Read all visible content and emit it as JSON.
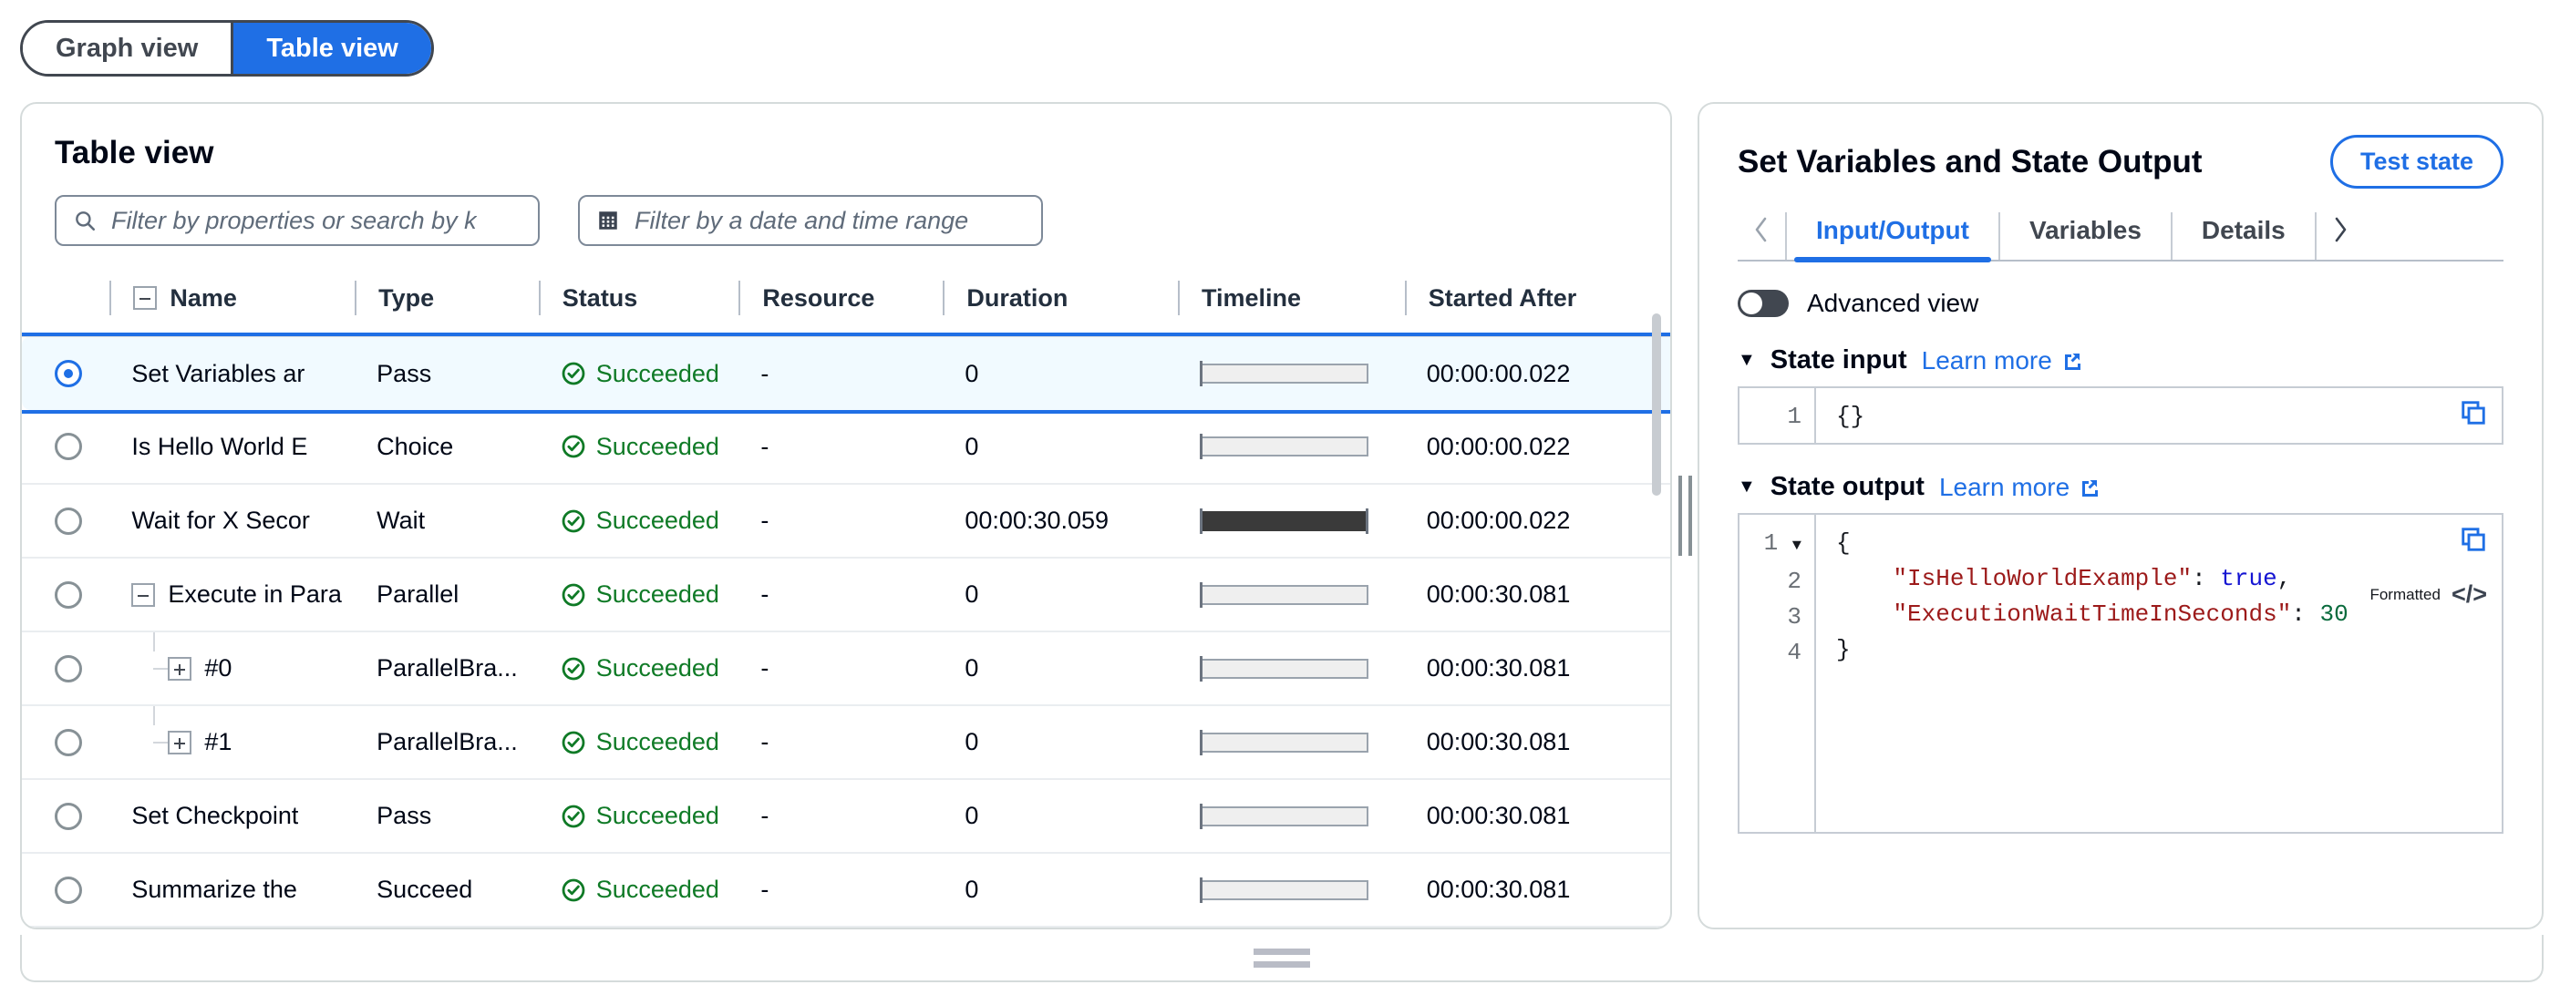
{
  "view_toggle": {
    "options": [
      {
        "label": "Graph view",
        "active": false
      },
      {
        "label": "Table view",
        "active": true
      }
    ]
  },
  "left_panel": {
    "title": "Table view",
    "search": {
      "placeholder": "Filter by properties or search by k",
      "icon": "search-icon"
    },
    "date_filter": {
      "placeholder": "Filter by a date and time range",
      "icon": "calendar-icon"
    },
    "columns": [
      {
        "key": "select",
        "label": ""
      },
      {
        "key": "name",
        "label": "Name"
      },
      {
        "key": "type",
        "label": "Type"
      },
      {
        "key": "status",
        "label": "Status"
      },
      {
        "key": "resource",
        "label": "Resource"
      },
      {
        "key": "duration",
        "label": "Duration"
      },
      {
        "key": "timeline",
        "label": "Timeline"
      },
      {
        "key": "started_after",
        "label": "Started After"
      }
    ],
    "rows": [
      {
        "selected": true,
        "indent": 0,
        "expander": "none",
        "name": "Set Variables ar",
        "type": "Pass",
        "status": "Succeeded",
        "resource": "-",
        "duration": "0",
        "timeline_filled": false,
        "started_after": "00:00:00.022"
      },
      {
        "selected": false,
        "indent": 0,
        "expander": "none",
        "name": "Is Hello World E",
        "type": "Choice",
        "status": "Succeeded",
        "resource": "-",
        "duration": "0",
        "timeline_filled": false,
        "started_after": "00:00:00.022"
      },
      {
        "selected": false,
        "indent": 0,
        "expander": "none",
        "name": "Wait for X Secor",
        "type": "Wait",
        "status": "Succeeded",
        "resource": "-",
        "duration": "00:00:30.059",
        "timeline_filled": true,
        "started_after": "00:00:00.022"
      },
      {
        "selected": false,
        "indent": 0,
        "expander": "minus",
        "name": "Execute in Para",
        "type": "Parallel",
        "status": "Succeeded",
        "resource": "-",
        "duration": "0",
        "timeline_filled": false,
        "started_after": "00:00:30.081"
      },
      {
        "selected": false,
        "indent": 1,
        "expander": "plus",
        "name": "#0",
        "type": "ParallelBra...",
        "status": "Succeeded",
        "resource": "-",
        "duration": "0",
        "timeline_filled": false,
        "started_after": "00:00:30.081"
      },
      {
        "selected": false,
        "indent": 1,
        "expander": "plus",
        "name": "#1",
        "type": "ParallelBra...",
        "status": "Succeeded",
        "resource": "-",
        "duration": "0",
        "timeline_filled": false,
        "started_after": "00:00:30.081"
      },
      {
        "selected": false,
        "indent": 0,
        "expander": "none",
        "name": "Set Checkpoint",
        "type": "Pass",
        "status": "Succeeded",
        "resource": "-",
        "duration": "0",
        "timeline_filled": false,
        "started_after": "00:00:30.081"
      },
      {
        "selected": false,
        "indent": 0,
        "expander": "none",
        "name": "Summarize the",
        "type": "Succeed",
        "status": "Succeeded",
        "resource": "-",
        "duration": "0",
        "timeline_filled": false,
        "started_after": "00:00:30.081"
      }
    ]
  },
  "right_panel": {
    "title": "Set Variables and State Output",
    "test_state_label": "Test state",
    "tabs": {
      "prev_icon": "chevron-left-icon",
      "next_icon": "chevron-right-icon",
      "items": [
        {
          "label": "Input/Output",
          "active": true
        },
        {
          "label": "Variables",
          "active": false
        },
        {
          "label": "Details",
          "active": false
        }
      ]
    },
    "advanced_view": {
      "label": "Advanced view",
      "enabled": false
    },
    "state_input": {
      "title": "State input",
      "learn_more": "Learn more",
      "line_numbers": [
        "1"
      ],
      "code_lines": [
        "{}"
      ]
    },
    "state_output": {
      "title": "State output",
      "learn_more": "Learn more",
      "line_numbers": [
        "1",
        "2",
        "3",
        "4"
      ],
      "formatted_label": "Formatted",
      "code_html": "{\n    <span class=\"k\">\"IsHelloWorldExample\"</span>: <span class=\"b\">true</span>,\n    <span class=\"k\">\"ExecutionWaitTimeInSeconds\"</span>: <span class=\"n\">30</span>\n}"
    }
  },
  "colors": {
    "accent": "#1f6fe5",
    "success": "#0f7a26",
    "selected_row_bg": "#f1faff",
    "border": "#d5dbdb"
  }
}
